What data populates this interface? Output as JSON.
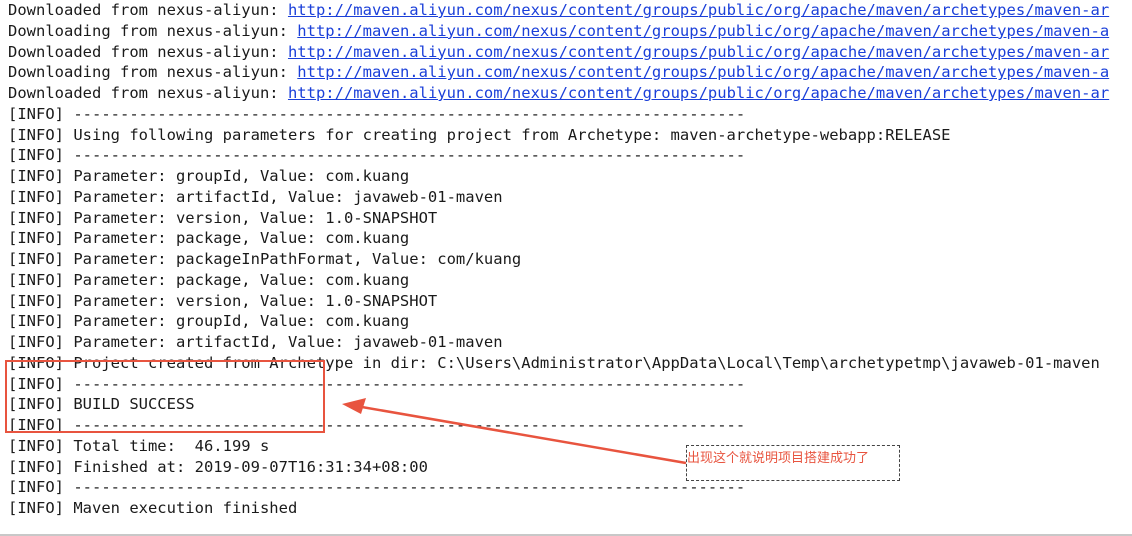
{
  "console": {
    "lines": [
      {
        "prefix": "Downloaded from nexus-aliyun: ",
        "url": "http://maven.aliyun.com/nexus/content/groups/public/org/apache/maven/archetypes/maven-ar"
      },
      {
        "prefix": "Downloading from nexus-aliyun: ",
        "url": "http://maven.aliyun.com/nexus/content/groups/public/org/apache/maven/archetypes/maven-a"
      },
      {
        "prefix": "Downloaded from nexus-aliyun: ",
        "url": "http://maven.aliyun.com/nexus/content/groups/public/org/apache/maven/archetypes/maven-ar"
      },
      {
        "prefix": "Downloading from nexus-aliyun: ",
        "url": "http://maven.aliyun.com/nexus/content/groups/public/org/apache/maven/archetypes/maven-a"
      },
      {
        "prefix": "Downloaded from nexus-aliyun: ",
        "url": "http://maven.aliyun.com/nexus/content/groups/public/org/apache/maven/archetypes/maven-ar"
      },
      {
        "text": "[INFO] ------------------------------------------------------------------------"
      },
      {
        "text": "[INFO] Using following parameters for creating project from Archetype: maven-archetype-webapp:RELEASE"
      },
      {
        "text": "[INFO] ------------------------------------------------------------------------"
      },
      {
        "text": "[INFO] Parameter: groupId, Value: com.kuang"
      },
      {
        "text": "[INFO] Parameter: artifactId, Value: javaweb-01-maven"
      },
      {
        "text": "[INFO] Parameter: version, Value: 1.0-SNAPSHOT"
      },
      {
        "text": "[INFO] Parameter: package, Value: com.kuang"
      },
      {
        "text": "[INFO] Parameter: packageInPathFormat, Value: com/kuang"
      },
      {
        "text": "[INFO] Parameter: package, Value: com.kuang"
      },
      {
        "text": "[INFO] Parameter: version, Value: 1.0-SNAPSHOT"
      },
      {
        "text": "[INFO] Parameter: groupId, Value: com.kuang"
      },
      {
        "text": "[INFO] Parameter: artifactId, Value: javaweb-01-maven"
      },
      {
        "text": "[INFO] Project created from Archetype in dir: C:\\Users\\Administrator\\AppData\\Local\\Temp\\archetypetmp\\javaweb-01-maven"
      },
      {
        "text": "[INFO] ------------------------------------------------------------------------"
      },
      {
        "text": "[INFO] BUILD SUCCESS"
      },
      {
        "text": "[INFO] ------------------------------------------------------------------------"
      },
      {
        "text": "[INFO] Total time:  46.199 s"
      },
      {
        "text": "[INFO] Finished at: 2019-09-07T16:31:34+08:00"
      },
      {
        "text": "[INFO] ------------------------------------------------------------------------"
      },
      {
        "text": "[INFO] Maven execution finished"
      }
    ]
  },
  "annotation": {
    "text": "出现这个就说明项目搭建成功了",
    "color": "#e8543f"
  },
  "colors": {
    "background": "#ffffff",
    "text": "#1a1a1a",
    "link": "#1a3fd9",
    "highlight": "#e8543f"
  }
}
